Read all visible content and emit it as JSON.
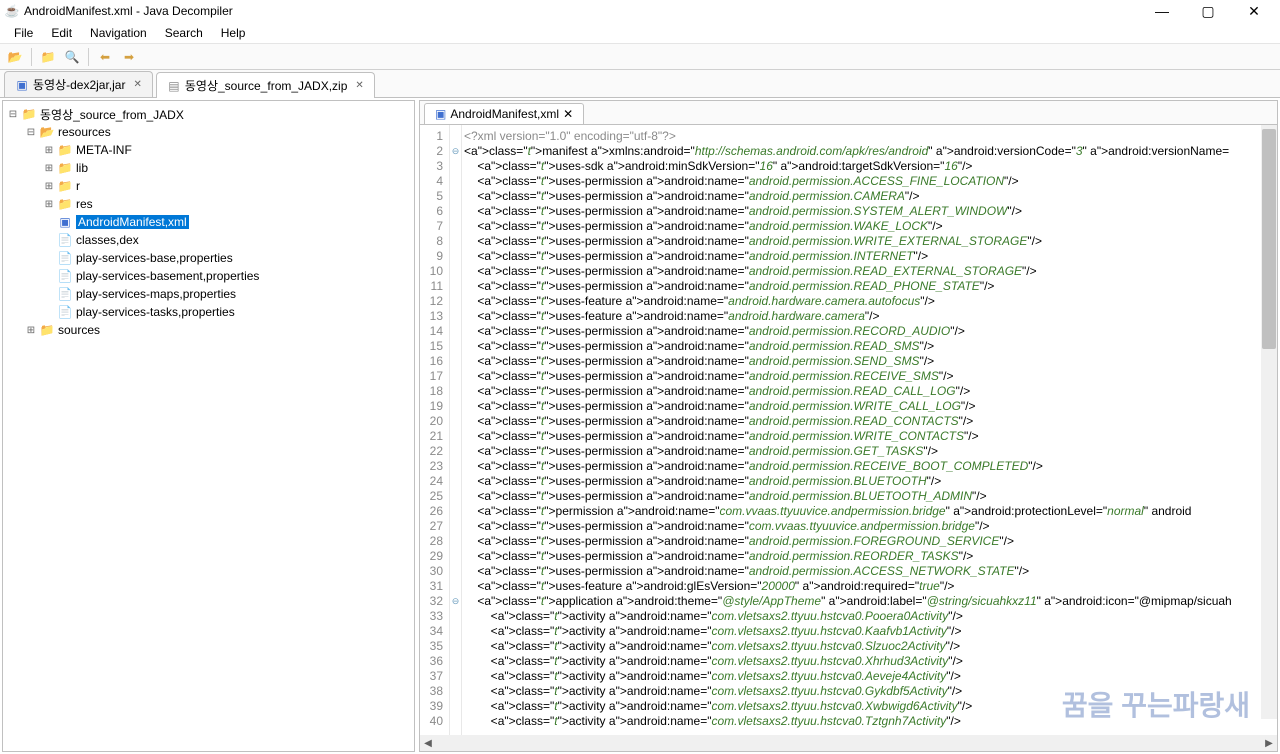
{
  "window": {
    "title": "AndroidManifest.xml - Java Decompiler"
  },
  "menu": {
    "file": "File",
    "edit": "Edit",
    "navigation": "Navigation",
    "search": "Search",
    "help": "Help"
  },
  "tabs": [
    {
      "label": "동영상-dex2jar,jar",
      "active": false
    },
    {
      "label": "동영상_source_from_JADX,zip",
      "active": true
    }
  ],
  "tree": {
    "root": "동영상_source_from_JADX",
    "resources": "resources",
    "meta": "META-INF",
    "lib": "lib",
    "r": "r",
    "res": "res",
    "manifest": "AndroidManifest,xml",
    "classes": "classes,dex",
    "psb": "play-services-base,properties",
    "psbm": "play-services-basement,properties",
    "psm": "play-services-maps,properties",
    "pst": "play-services-tasks,properties",
    "sources": "sources"
  },
  "editor": {
    "tab": "AndroidManifest,xml"
  },
  "code": [
    "<?xml version=\"1.0\" encoding=\"utf-8\"?>",
    "<manifest xmlns:android=\"http://schemas.android.com/apk/res/android\" android:versionCode=\"3\" android:versionName=",
    "    <uses-sdk android:minSdkVersion=\"16\" android:targetSdkVersion=\"16\"/>",
    "    <uses-permission android:name=\"android.permission.ACCESS_FINE_LOCATION\"/>",
    "    <uses-permission android:name=\"android.permission.CAMERA\"/>",
    "    <uses-permission android:name=\"android.permission.SYSTEM_ALERT_WINDOW\"/>",
    "    <uses-permission android:name=\"android.permission.WAKE_LOCK\"/>",
    "    <uses-permission android:name=\"android.permission.WRITE_EXTERNAL_STORAGE\"/>",
    "    <uses-permission android:name=\"android.permission.INTERNET\"/>",
    "    <uses-permission android:name=\"android.permission.READ_EXTERNAL_STORAGE\"/>",
    "    <uses-permission android:name=\"android.permission.READ_PHONE_STATE\"/>",
    "    <uses-feature android:name=\"android.hardware.camera.autofocus\"/>",
    "    <uses-feature android:name=\"android.hardware.camera\"/>",
    "    <uses-permission android:name=\"android.permission.RECORD_AUDIO\"/>",
    "    <uses-permission android:name=\"android.permission.READ_SMS\"/>",
    "    <uses-permission android:name=\"android.permission.SEND_SMS\"/>",
    "    <uses-permission android:name=\"android.permission.RECEIVE_SMS\"/>",
    "    <uses-permission android:name=\"android.permission.READ_CALL_LOG\"/>",
    "    <uses-permission android:name=\"android.permission.WRITE_CALL_LOG\"/>",
    "    <uses-permission android:name=\"android.permission.READ_CONTACTS\"/>",
    "    <uses-permission android:name=\"android.permission.WRITE_CONTACTS\"/>",
    "    <uses-permission android:name=\"android.permission.GET_TASKS\"/>",
    "    <uses-permission android:name=\"android.permission.RECEIVE_BOOT_COMPLETED\"/>",
    "    <uses-permission android:name=\"android.permission.BLUETOOTH\"/>",
    "    <uses-permission android:name=\"android.permission.BLUETOOTH_ADMIN\"/>",
    "    <permission android:name=\"com.vvaas.ttyuuvice.andpermission.bridge\" android:protectionLevel=\"normal\" android",
    "    <uses-permission android:name=\"com.vvaas.ttyuuvice.andpermission.bridge\"/>",
    "    <uses-permission android:name=\"android.permission.FOREGROUND_SERVICE\"/>",
    "    <uses-permission android:name=\"android.permission.REORDER_TASKS\"/>",
    "    <uses-permission android:name=\"android.permission.ACCESS_NETWORK_STATE\"/>",
    "    <uses-feature android:glEsVersion=\"20000\" android:required=\"true\"/>",
    "    <application android:theme=\"@style/AppTheme\" android:label=\"@string/sicuahkxz11\" android:icon=\"@mipmap/sicuah",
    "        <activity android:name=\"com.vletsaxs2.ttyuu.hstcva0.Pooera0Activity\"/>",
    "        <activity android:name=\"com.vletsaxs2.ttyuu.hstcva0.Kaafvb1Activity\"/>",
    "        <activity android:name=\"com.vletsaxs2.ttyuu.hstcva0.Slzuoc2Activity\"/>",
    "        <activity android:name=\"com.vletsaxs2.ttyuu.hstcva0.Xhrhud3Activity\"/>",
    "        <activity android:name=\"com.vletsaxs2.ttyuu.hstcva0.Aeveje4Activity\"/>",
    "        <activity android:name=\"com.vletsaxs2.ttyuu.hstcva0.Gykdbf5Activity\"/>",
    "        <activity android:name=\"com.vletsaxs2.ttyuu.hstcva0.Xwbwigd6Activity\"/>",
    "        <activity android:name=\"com.vletsaxs2.ttyuu.hstcva0.Tztgnh7Activity\"/>"
  ],
  "watermark": "꿈을 꾸는파랑새"
}
